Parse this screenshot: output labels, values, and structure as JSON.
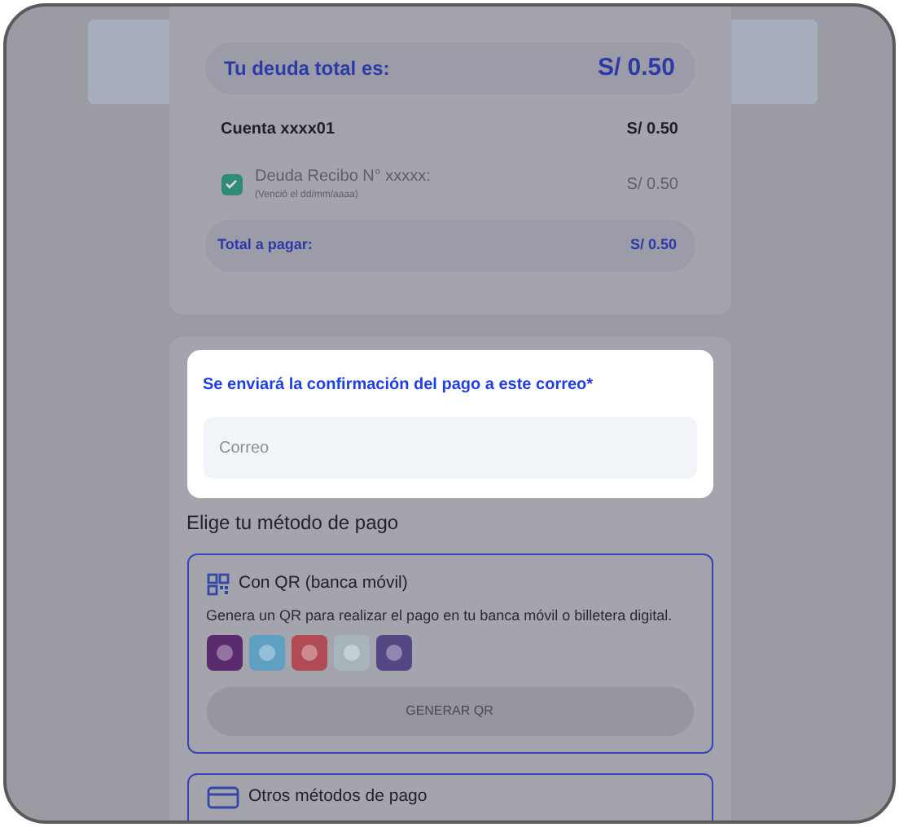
{
  "debt_summary": {
    "total_label": "Tu deuda total es:",
    "total_amount": "S/ 0.50",
    "account": {
      "label": "Cuenta xxxx01",
      "amount": "S/ 0.50"
    },
    "items": [
      {
        "title": "Deuda Recibo N° xxxxx:",
        "note": "(Venció el dd/mm/aaaa)",
        "amount": "S/ 0.50",
        "checked": true
      }
    ],
    "pay_label": "Total a pagar:",
    "pay_amount": "S/ 0.50"
  },
  "email": {
    "label": "Se enviará la confirmación del pago a este correo*",
    "placeholder": "Correo"
  },
  "payment": {
    "heading": "Elige tu método de pago",
    "methods": [
      {
        "kind": "qr",
        "title": "Con QR (banca móvil)",
        "description": "Genera un QR para realizar el pago en tu banca móvil o billetera digital.",
        "wallets": [
          {
            "color": "#5a2a6e"
          },
          {
            "color": "#5f9fc2"
          },
          {
            "color": "#b04a55"
          },
          {
            "color": "#a8b4bc"
          },
          {
            "color": "#554786"
          }
        ],
        "button": "GENERAR QR"
      },
      {
        "kind": "other",
        "title": "Otros métodos de pago"
      }
    ]
  }
}
